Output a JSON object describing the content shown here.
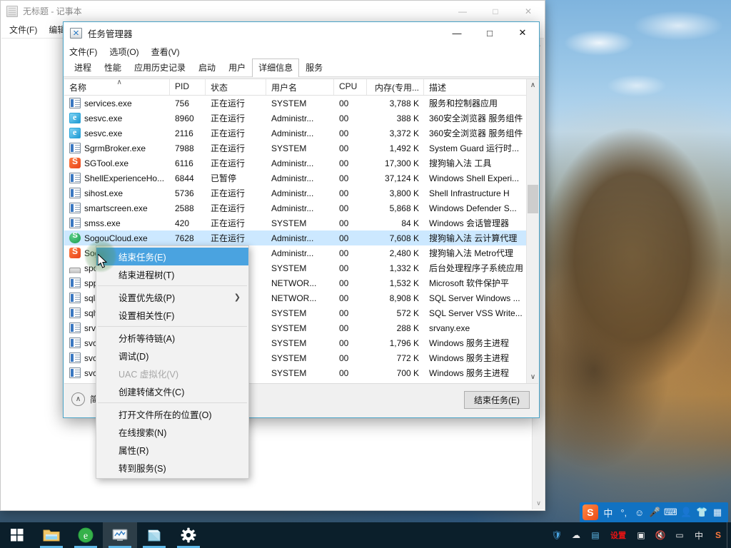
{
  "notepad": {
    "title": "无标题 - 记事本",
    "menu": [
      "文件(F)",
      "编辑"
    ],
    "buttons": {
      "minimize": "—",
      "maximize": "□",
      "close": "✕"
    }
  },
  "taskmgr": {
    "title": "任务管理器",
    "menu": [
      "文件(F)",
      "选项(O)",
      "查看(V)"
    ],
    "buttons": {
      "minimize": "—",
      "maximize": "□",
      "close": "✕"
    },
    "tabs": [
      {
        "label": "进程",
        "selected": false
      },
      {
        "label": "性能",
        "selected": false
      },
      {
        "label": "应用历史记录",
        "selected": false
      },
      {
        "label": "启动",
        "selected": false
      },
      {
        "label": "用户",
        "selected": false
      },
      {
        "label": "详细信息",
        "selected": true
      },
      {
        "label": "服务",
        "selected": false
      }
    ],
    "columns": [
      {
        "key": "name",
        "label": "名称",
        "width": 148,
        "align": "left",
        "sorted": true,
        "sort_arrow": "∧"
      },
      {
        "key": "pid",
        "label": "PID",
        "width": 50,
        "align": "left"
      },
      {
        "key": "status",
        "label": "状态",
        "width": 85,
        "align": "left"
      },
      {
        "key": "user",
        "label": "用户名",
        "width": 95,
        "align": "left"
      },
      {
        "key": "cpu",
        "label": "CPU",
        "width": 46,
        "align": "left"
      },
      {
        "key": "mem",
        "label": "内存(专用...",
        "width": 80,
        "align": "right"
      },
      {
        "key": "desc",
        "label": "描述",
        "width": 145,
        "align": "left"
      }
    ],
    "rows": [
      {
        "icon": "generic-process-icon",
        "name": "services.exe",
        "pid": "756",
        "status": "正在运行",
        "user": "SYSTEM",
        "cpu": "00",
        "mem": "3,788 K",
        "desc": "服务和控制器应用",
        "selected": false
      },
      {
        "icon": "browser-360-icon",
        "name": "sesvc.exe",
        "pid": "8960",
        "status": "正在运行",
        "user": "Administr...",
        "cpu": "00",
        "mem": "388 K",
        "desc": "360安全浏览器 服务组件",
        "selected": false
      },
      {
        "icon": "browser-360-icon",
        "name": "sesvc.exe",
        "pid": "2116",
        "status": "正在运行",
        "user": "Administr...",
        "cpu": "00",
        "mem": "3,372 K",
        "desc": "360安全浏览器 服务组件",
        "selected": false
      },
      {
        "icon": "generic-process-icon",
        "name": "SgrmBroker.exe",
        "pid": "7988",
        "status": "正在运行",
        "user": "SYSTEM",
        "cpu": "00",
        "mem": "1,492 K",
        "desc": "System Guard 运行时...",
        "selected": false
      },
      {
        "icon": "sogou-s-icon",
        "name": "SGTool.exe",
        "pid": "6116",
        "status": "正在运行",
        "user": "Administr...",
        "cpu": "00",
        "mem": "17,300 K",
        "desc": "搜狗输入法 工具",
        "selected": false
      },
      {
        "icon": "generic-process-icon",
        "name": "ShellExperienceHo...",
        "pid": "6844",
        "status": "已暂停",
        "user": "Administr...",
        "cpu": "00",
        "mem": "37,124 K",
        "desc": "Windows Shell Experi...",
        "selected": false
      },
      {
        "icon": "generic-process-icon",
        "name": "sihost.exe",
        "pid": "5736",
        "status": "正在运行",
        "user": "Administr...",
        "cpu": "00",
        "mem": "3,800 K",
        "desc": "Shell Infrastructure H",
        "selected": false
      },
      {
        "icon": "generic-process-icon",
        "name": "smartscreen.exe",
        "pid": "2588",
        "status": "正在运行",
        "user": "Administr...",
        "cpu": "00",
        "mem": "5,868 K",
        "desc": "Windows Defender S...",
        "selected": false
      },
      {
        "icon": "generic-process-icon",
        "name": "smss.exe",
        "pid": "420",
        "status": "正在运行",
        "user": "SYSTEM",
        "cpu": "00",
        "mem": "84 K",
        "desc": "Windows 会话管理器",
        "selected": false
      },
      {
        "icon": "sogou-cloud-icon",
        "name": "SogouCloud.exe",
        "pid": "7628",
        "status": "正在运行",
        "user": "Administr...",
        "cpu": "00",
        "mem": "7,608 K",
        "desc": "搜狗输入法 云计算代理",
        "selected": true
      },
      {
        "icon": "sogou-s-icon",
        "name": "Sog",
        "pid": "",
        "status": "",
        "user": "Administr...",
        "cpu": "00",
        "mem": "2,480 K",
        "desc": "搜狗输入法 Metro代理",
        "selected": false
      },
      {
        "icon": "printer-icon",
        "name": "spo",
        "pid": "",
        "status": "",
        "user": "SYSTEM",
        "cpu": "00",
        "mem": "1,332 K",
        "desc": "后台处理程序子系统应用",
        "selected": false
      },
      {
        "icon": "generic-process-icon",
        "name": "spp",
        "pid": "",
        "status": "",
        "user": "NETWOR...",
        "cpu": "00",
        "mem": "1,532 K",
        "desc": "Microsoft 软件保护平",
        "selected": false
      },
      {
        "icon": "generic-process-icon",
        "name": "sqls",
        "pid": "",
        "status": "",
        "user": "NETWOR...",
        "cpu": "00",
        "mem": "8,908 K",
        "desc": "SQL Server Windows ...",
        "selected": false
      },
      {
        "icon": "generic-process-icon",
        "name": "sqlw",
        "pid": "",
        "status": "",
        "user": "SYSTEM",
        "cpu": "00",
        "mem": "572 K",
        "desc": "SQL Server VSS Write...",
        "selected": false
      },
      {
        "icon": "generic-process-icon",
        "name": "srva",
        "pid": "",
        "status": "",
        "user": "SYSTEM",
        "cpu": "00",
        "mem": "288 K",
        "desc": "srvany.exe",
        "selected": false
      },
      {
        "icon": "generic-process-icon",
        "name": "svch",
        "pid": "",
        "status": "",
        "user": "SYSTEM",
        "cpu": "00",
        "mem": "1,796 K",
        "desc": "Windows 服务主进程",
        "selected": false
      },
      {
        "icon": "generic-process-icon",
        "name": "svch",
        "pid": "",
        "status": "",
        "user": "SYSTEM",
        "cpu": "00",
        "mem": "772 K",
        "desc": "Windows 服务主进程",
        "selected": false
      },
      {
        "icon": "generic-process-icon",
        "name": "svch",
        "pid": "",
        "status": "",
        "user": "SYSTEM",
        "cpu": "00",
        "mem": "700 K",
        "desc": "Windows 服务主进程",
        "selected": false
      }
    ],
    "footer": {
      "fewer_details": "简",
      "fewer_details_icon": "chevron-up-circle-icon",
      "end_task": "结束任务(E)"
    },
    "scrollbar": {
      "up": "∧",
      "down": "∨"
    }
  },
  "context_menu": {
    "items": [
      {
        "label": "结束任务(E)",
        "highlighted": true,
        "disabled": false,
        "submenu": false
      },
      {
        "label": "结束进程树(T)",
        "highlighted": false,
        "disabled": false,
        "submenu": false
      },
      {
        "separator": true
      },
      {
        "label": "设置优先级(P)",
        "highlighted": false,
        "disabled": false,
        "submenu": true,
        "submenu_glyph": "❯"
      },
      {
        "label": "设置相关性(F)",
        "highlighted": false,
        "disabled": false,
        "submenu": false
      },
      {
        "separator": true
      },
      {
        "label": "分析等待链(A)",
        "highlighted": false,
        "disabled": false,
        "submenu": false
      },
      {
        "label": "调试(D)",
        "highlighted": false,
        "disabled": false,
        "submenu": false
      },
      {
        "label": "UAC 虚拟化(V)",
        "highlighted": false,
        "disabled": true,
        "submenu": false
      },
      {
        "label": "创建转储文件(C)",
        "highlighted": false,
        "disabled": false,
        "submenu": false
      },
      {
        "separator": true
      },
      {
        "label": "打开文件所在的位置(O)",
        "highlighted": false,
        "disabled": false,
        "submenu": false
      },
      {
        "label": "在线搜索(N)",
        "highlighted": false,
        "disabled": false,
        "submenu": false
      },
      {
        "label": "属性(R)",
        "highlighted": false,
        "disabled": false,
        "submenu": false
      },
      {
        "label": "转到服务(S)",
        "highlighted": false,
        "disabled": false,
        "submenu": false
      }
    ]
  },
  "ime_bar": {
    "items": [
      "sogou-logo-icon",
      "中",
      "°,",
      "☺",
      "🎤",
      "⌨",
      "👤",
      "👕",
      "▦"
    ],
    "mode_label": "中"
  },
  "taskbar": {
    "start_icon": "windows-start-icon",
    "items": [
      {
        "icon": "file-explorer-icon",
        "active": false,
        "running": true
      },
      {
        "icon": "360-browser-icon",
        "active": false,
        "running": true
      },
      {
        "icon": "task-manager-icon",
        "active": true,
        "running": true
      },
      {
        "icon": "notepad-icon",
        "active": false,
        "running": true
      },
      {
        "icon": "settings-gear-icon",
        "active": false,
        "running": true
      }
    ],
    "tray": [
      {
        "icon": "tencent-shield-icon",
        "glyph": "🛡"
      },
      {
        "icon": "cloud-icon",
        "glyph": "☁"
      },
      {
        "icon": "network-share-icon",
        "glyph": "▤"
      },
      {
        "icon": "red-text-icon",
        "glyph": "设置"
      },
      {
        "icon": "action-center-icon",
        "glyph": "▣"
      },
      {
        "icon": "volume-muted-icon",
        "glyph": "🔇"
      },
      {
        "icon": "battery-icon",
        "glyph": "▭"
      },
      {
        "icon": "ime-chinese-icon",
        "glyph": "中"
      },
      {
        "icon": "sogou-tray-icon",
        "glyph": "S"
      }
    ]
  },
  "colors": {
    "selection": "#cce8ff",
    "menu_highlight": "#4aa3e0",
    "window_border": "#4aa3c7",
    "taskbar": "#0b1f2b",
    "ime_bar": "#1172c2"
  }
}
